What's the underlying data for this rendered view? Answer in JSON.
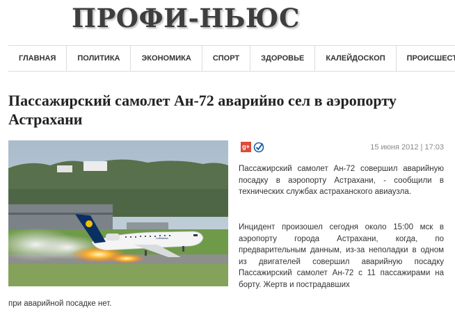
{
  "site": {
    "logo": "ПРОФИ-НЬЮС"
  },
  "nav": {
    "items": [
      {
        "label": "ГЛАВНАЯ"
      },
      {
        "label": "ПОЛИТИКА"
      },
      {
        "label": "ЭКОНОМИКА"
      },
      {
        "label": "СПОРТ"
      },
      {
        "label": "ЗДОРОВЬЕ"
      },
      {
        "label": "КАЛЕЙДОСКОП"
      },
      {
        "label": "ПРОИСШЕСТВИЯ"
      }
    ]
  },
  "article": {
    "title": "Пассажирский самолет Ан-72 аварийно сел в аэропорту Астрахани",
    "date": "15 июня 2012 | 17:03",
    "photo": {
      "livery_text": "Lufthansa"
    },
    "share": {
      "gplus_label": "g+",
      "icons": [
        "google-plus-icon",
        "check-icon"
      ]
    },
    "paragraph1": "Пассажирский самолет Ан-72 совершил аварийную посадку в аэропорту Астрахани, - сообщили в технических службах астраханского авиаузла.",
    "paragraph2": "Инцидент произошел сегодня около 15:00 мск в аэропорту города Астрахани, когда, по предварительным данным, из-за неполадки в одном из двигателей совершил аварийную посадку Пассажирский самолет Ан-72 с 11 пассажирами на борту. Жертв и пострадавших",
    "paragraph2_tail": "при аварийной посадке нет."
  },
  "colors": {
    "gplus": "#dd4b39",
    "check": "#1b5fa8",
    "nav_border": "#dcdcdc"
  }
}
